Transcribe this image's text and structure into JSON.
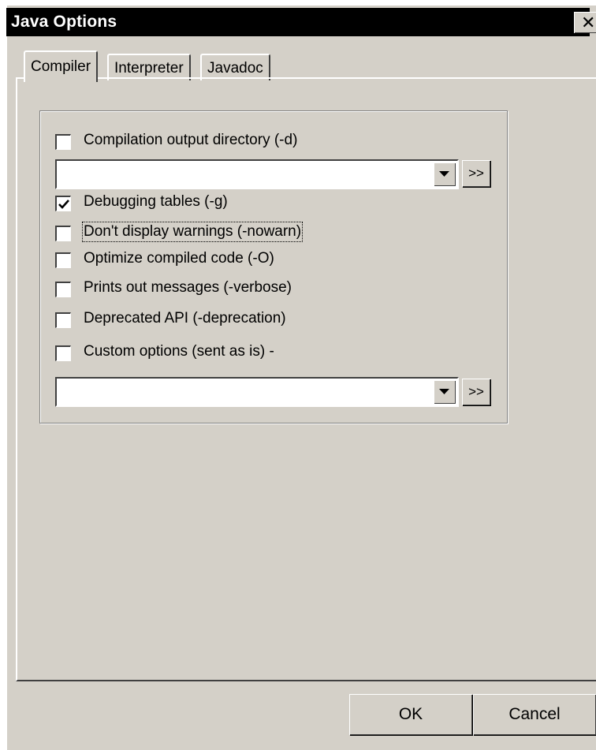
{
  "window": {
    "title": "Java Options"
  },
  "tabs": [
    {
      "label": "Compiler",
      "active": true
    },
    {
      "label": "Interpreter",
      "active": false
    },
    {
      "label": "Javadoc",
      "active": false
    }
  ],
  "options": {
    "output_dir": {
      "label": "Compilation output directory (-d)",
      "checked": false,
      "value": ""
    },
    "debug": {
      "label": "Debugging tables (-g)",
      "checked": true
    },
    "nowarn": {
      "label": "Don't display warnings (-nowarn)",
      "checked": false
    },
    "optimize": {
      "label": "Optimize compiled code (-O)",
      "checked": false
    },
    "verbose": {
      "label": "Prints out messages (-verbose)",
      "checked": false
    },
    "deprecation": {
      "label": "Deprecated API (-deprecation)",
      "checked": false
    },
    "custom": {
      "label": "Custom options (sent as is) -",
      "checked": false,
      "value": ""
    }
  },
  "browse_label": ">>",
  "buttons": {
    "ok": "OK",
    "cancel": "Cancel"
  },
  "icons": {
    "close": "close-icon",
    "dropdown": "dropdown-arrow-icon",
    "check": "checkmark-icon"
  }
}
